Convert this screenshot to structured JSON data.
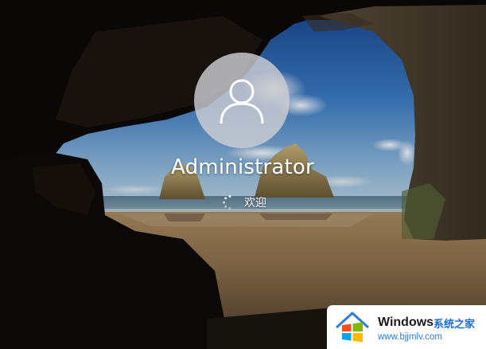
{
  "login": {
    "username": "Administrator",
    "status_text": "欢迎"
  },
  "icons": {
    "avatar": "user-silhouette-icon",
    "spinner": "loading-spinner-icon",
    "logo": "windows-logo-icon"
  },
  "watermark": {
    "title": "Windows",
    "subtitle_cn": "系统之家",
    "url": "www.bjjmlv.com"
  },
  "colors": {
    "watermark_blue": "#1a6fd4",
    "text": "#ffffff",
    "avatar_circle": "#cdcdd2"
  }
}
